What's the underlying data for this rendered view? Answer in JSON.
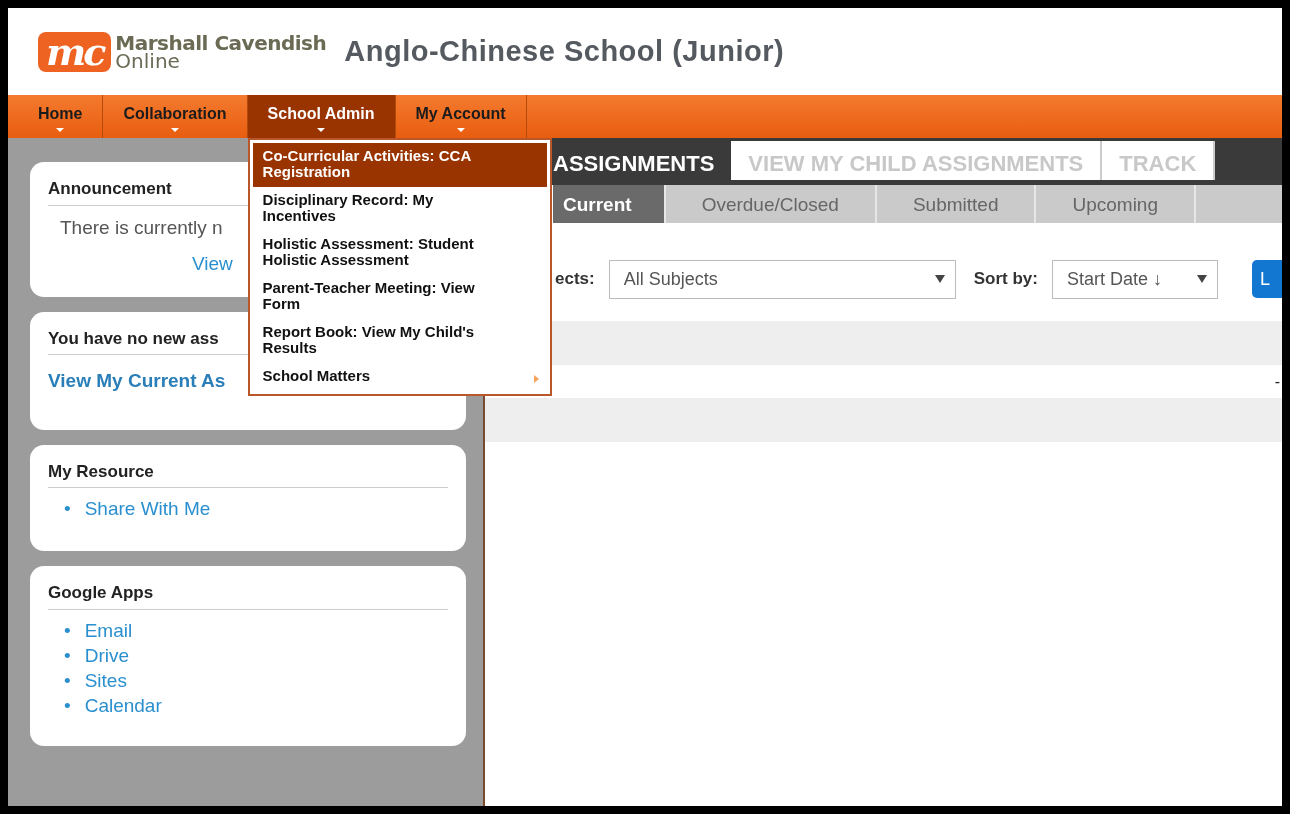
{
  "header": {
    "logo": {
      "mark": "mc",
      "name": "Marshall Cavendish",
      "tagline": "Online"
    },
    "school": "Anglo-Chinese School (Junior)"
  },
  "menu": [
    {
      "label": "Home",
      "selected": false
    },
    {
      "label": "Collaboration",
      "selected": false
    },
    {
      "label": "School Admin",
      "selected": true
    },
    {
      "label": "My Account",
      "selected": false
    }
  ],
  "dropdown": {
    "items": [
      {
        "label": "Co-Curricular Activities: CCA Registration",
        "selected": true,
        "submenu": false
      },
      {
        "label": "Disciplinary Record: My Incentives",
        "selected": false,
        "submenu": false
      },
      {
        "label": "Holistic Assessment: Student Holistic Assessment",
        "selected": false,
        "submenu": false
      },
      {
        "label": "Parent-Teacher Meeting: View Form",
        "selected": false,
        "submenu": false
      },
      {
        "label": "Report Book: View My Child's Results",
        "selected": false,
        "submenu": false
      },
      {
        "label": "School Matters",
        "selected": false,
        "submenu": true
      }
    ]
  },
  "sidebar": [
    {
      "kind": "notice",
      "title": "Announcement",
      "text": "There is currently n",
      "link": "View"
    },
    {
      "kind": "link",
      "title": "You have no new ass",
      "link": "View My Current As"
    },
    {
      "kind": "list",
      "title": "My Resource",
      "items": [
        {
          "bullet": "•",
          "label": "Share With Me"
        }
      ]
    },
    {
      "kind": "list",
      "title": "Google Apps",
      "items": [
        {
          "bullet": "•",
          "label": "Email"
        },
        {
          "bullet": "•",
          "label": "Drive"
        },
        {
          "bullet": "•",
          "label": "Sites"
        },
        {
          "bullet": "•",
          "label": "Calendar"
        }
      ]
    }
  ],
  "tabs": [
    {
      "label": "ASSIGNMENTS",
      "selected": true
    },
    {
      "label": "VIEW MY CHILD ASSIGNMENTS",
      "selected": false
    },
    {
      "label": "TRACK",
      "selected": false
    }
  ],
  "subtabs": [
    {
      "label": "Current",
      "selected": true
    },
    {
      "label": "Overdue/Closed",
      "selected": false
    },
    {
      "label": "Submitted",
      "selected": false
    },
    {
      "label": "Upcoming",
      "selected": false
    }
  ],
  "filters": {
    "subjects_label": "ects:",
    "subjects": "All Subjects",
    "sort_label": "Sort by:",
    "sort": "Start Date ↓",
    "button": "L"
  },
  "table": {
    "rows": [
      {
        "column_1": "-"
      }
    ]
  }
}
